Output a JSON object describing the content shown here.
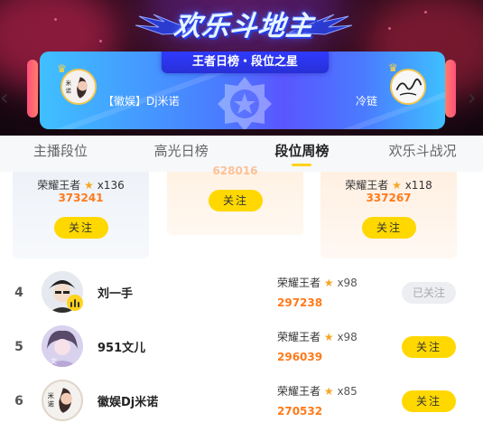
{
  "banner": {
    "logo_text": "欢乐斗地主",
    "ribbon_title": "王者日榜・段位之星",
    "left_user": "【徽娱】Dj米诺",
    "right_user": "冷链"
  },
  "nav": {
    "prev_arrow": "‹",
    "next_arrow": "›"
  },
  "tabs": [
    {
      "label": "主播段位",
      "active": false
    },
    {
      "label": "高光日榜",
      "active": false
    },
    {
      "label": "段位周榜",
      "active": true
    },
    {
      "label": "欢乐斗战况",
      "active": false
    }
  ],
  "podium": {
    "second": {
      "tier": "荣耀王者",
      "star": "★",
      "stars": "x136",
      "score": "373241",
      "follow": "关注"
    },
    "first": {
      "score_partial": "628016",
      "follow": "关注"
    },
    "third": {
      "tier": "荣耀王者",
      "star": "★",
      "stars": "x118",
      "score": "337267",
      "follow": "关注"
    }
  },
  "rows": [
    {
      "rank": "4",
      "name": "刘一手",
      "tier": "荣耀王者",
      "star": "★",
      "stars": "x98",
      "score": "297238",
      "button": "已关注",
      "followed": true,
      "live": true
    },
    {
      "rank": "5",
      "name": "951文儿",
      "tier": "荣耀王者",
      "star": "★",
      "stars": "x98",
      "score": "296039",
      "button": "关注",
      "followed": false,
      "live": false
    },
    {
      "rank": "6",
      "name": "徽娱Dj米诺",
      "tier": "荣耀王者",
      "star": "★",
      "stars": "x85",
      "score": "270532",
      "button": "关注",
      "followed": false,
      "live": false
    }
  ],
  "colors": {
    "accent_yellow": "#ffd800",
    "score_orange": "#ff7a1a",
    "star_gold": "#f5a623",
    "card_blue": "#4a7bff"
  }
}
